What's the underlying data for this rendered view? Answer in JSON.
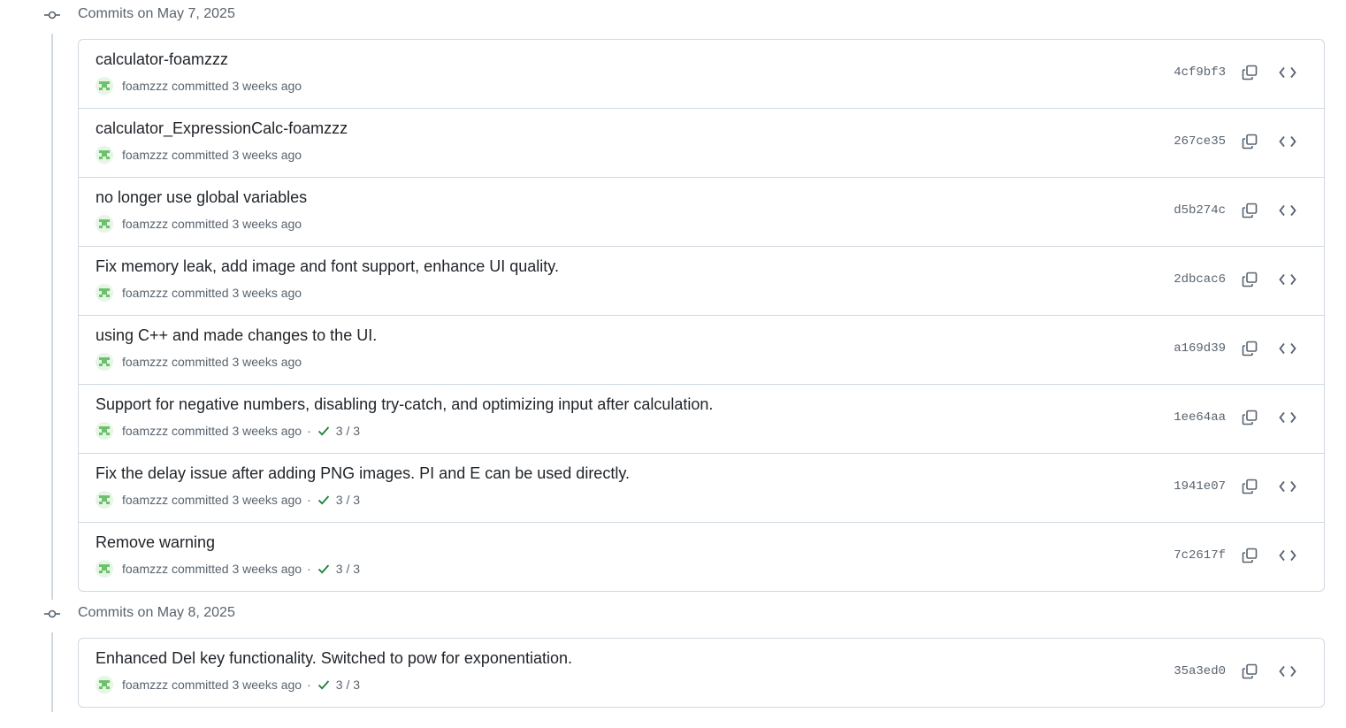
{
  "groups": [
    {
      "title": "Commits on May 7, 2025",
      "commits": [
        {
          "message": "calculator-foamzzz",
          "author": "foamzzz",
          "action": "committed",
          "time": "3 weeks ago",
          "checks": "",
          "sha": "4cf9bf3"
        },
        {
          "message": "calculator_ExpressionCalc-foamzzz",
          "author": "foamzzz",
          "action": "committed",
          "time": "3 weeks ago",
          "checks": "",
          "sha": "267ce35"
        },
        {
          "message": "no longer use global variables",
          "author": "foamzzz",
          "action": "committed",
          "time": "3 weeks ago",
          "checks": "",
          "sha": "d5b274c"
        },
        {
          "message": "Fix memory leak, add image and font support, enhance UI quality.",
          "author": "foamzzz",
          "action": "committed",
          "time": "3 weeks ago",
          "checks": "",
          "sha": "2dbcac6"
        },
        {
          "message": "using C++ and made changes to the UI.",
          "author": "foamzzz",
          "action": "committed",
          "time": "3 weeks ago",
          "checks": "",
          "sha": "a169d39"
        },
        {
          "message": "Support for negative numbers, disabling try-catch, and optimizing input after calculation.",
          "author": "foamzzz",
          "action": "committed",
          "time": "3 weeks ago",
          "checks": "3 / 3",
          "sha": "1ee64aa"
        },
        {
          "message": "Fix the delay issue after adding PNG images. PI and E can be used directly.",
          "author": "foamzzz",
          "action": "committed",
          "time": "3 weeks ago",
          "checks": "3 / 3",
          "sha": "1941e07"
        },
        {
          "message": "Remove warning",
          "author": "foamzzz",
          "action": "committed",
          "time": "3 weeks ago",
          "checks": "3 / 3",
          "sha": "7c2617f"
        }
      ]
    },
    {
      "title": "Commits on May 8, 2025",
      "commits": [
        {
          "message": "Enhanced Del key functionality. Switched to pow for exponentiation.",
          "author": "foamzzz",
          "action": "committed",
          "time": "3 weeks ago",
          "checks": "3 / 3",
          "sha": "35a3ed0"
        }
      ]
    }
  ],
  "icons": {
    "commit": "git-commit-icon",
    "avatar": "identicon-avatar",
    "check": "check-icon",
    "copy": "copy-icon",
    "browse": "code-icon"
  },
  "colors": {
    "check_green": "#1a7f37",
    "avatar_green": "#6cc26c",
    "muted_text": "#59636e",
    "border": "#d1d9e0"
  }
}
